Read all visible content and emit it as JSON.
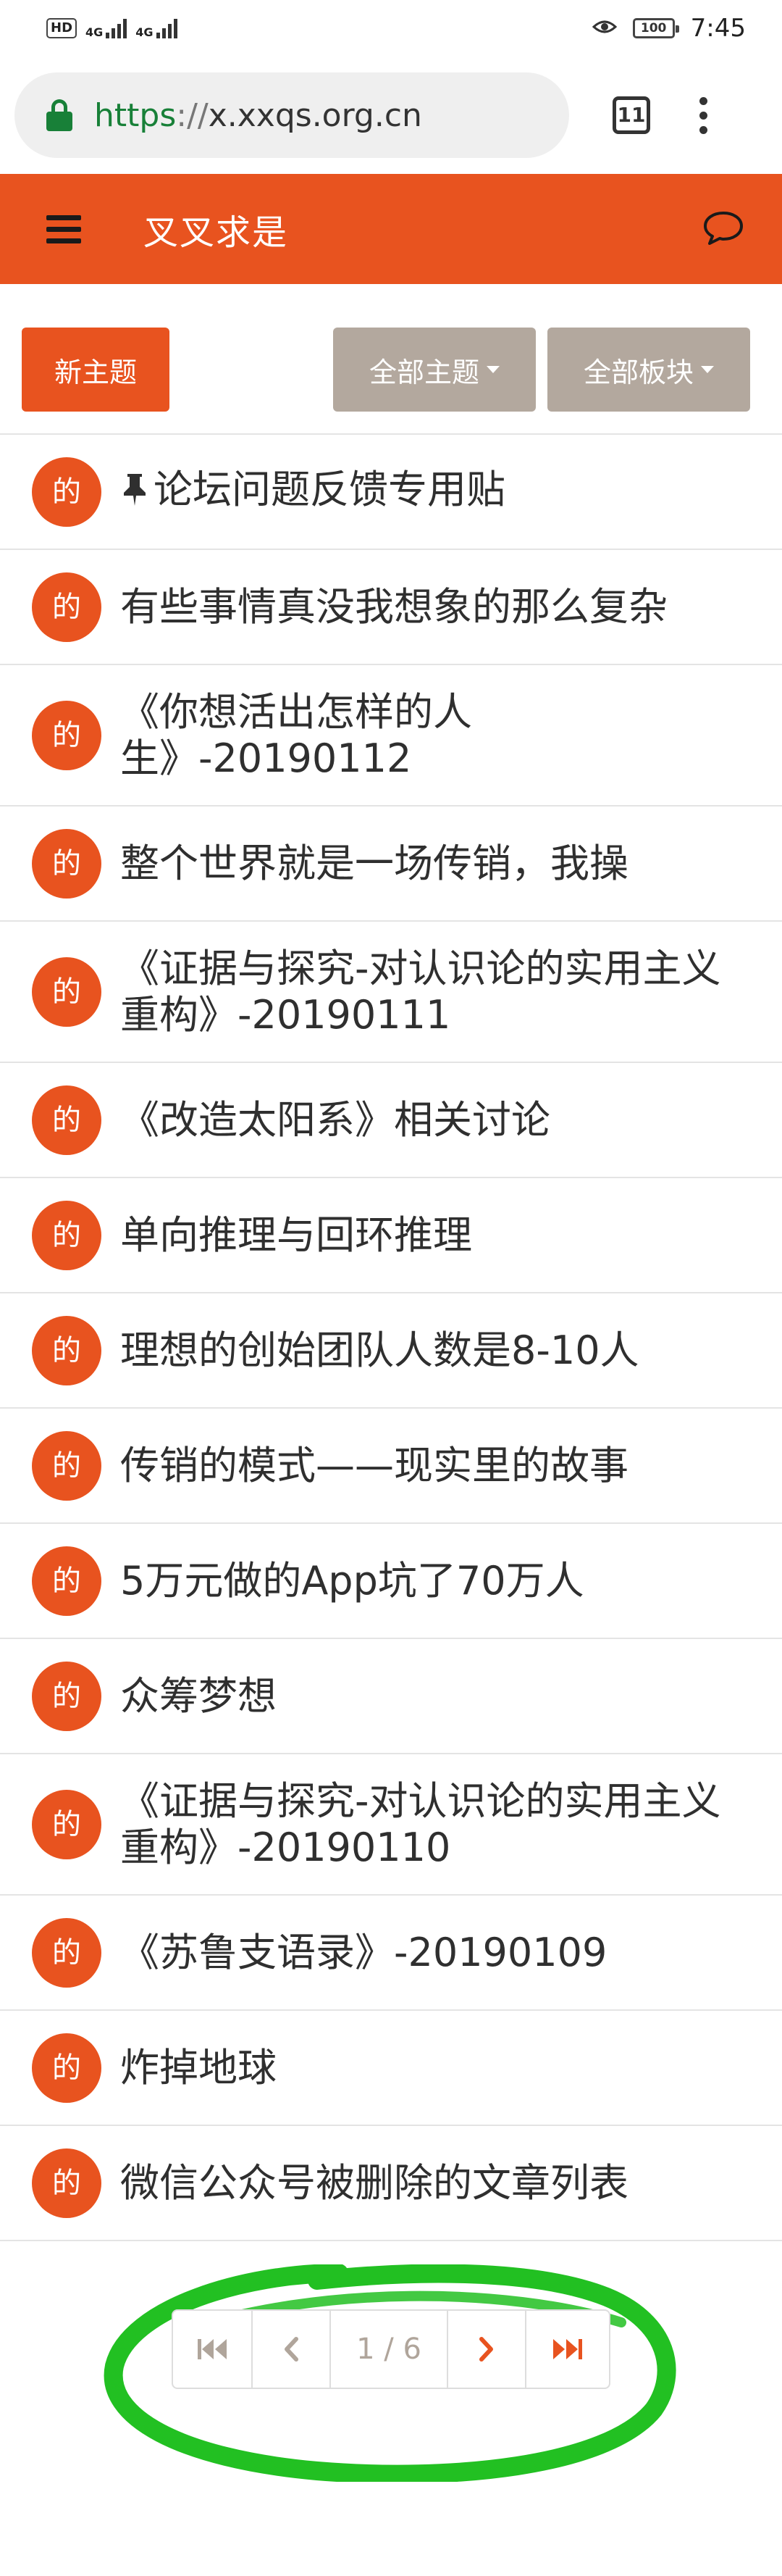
{
  "status_bar": {
    "hd": "HD",
    "net1": "4G",
    "net2": "4G",
    "battery": "100",
    "time": "7:45"
  },
  "browser": {
    "url_scheme": "https",
    "url_sep": "://",
    "url_host": "x.xxqs.org.cn",
    "tab_count": "11"
  },
  "header": {
    "title": "叉叉求是"
  },
  "actions": {
    "new_topic": "新主题",
    "all_topics": "全部主题",
    "all_boards": "全部板块"
  },
  "topics": [
    {
      "avatar": "的",
      "title": "论坛问题反馈专用贴",
      "pinned": true
    },
    {
      "avatar": "的",
      "title": "有些事情真没我想象的那么复杂"
    },
    {
      "avatar": "的",
      "title": "《你想活出怎样的人生》-20190112"
    },
    {
      "avatar": "的",
      "title": "整个世界就是一场传销，我操"
    },
    {
      "avatar": "的",
      "title": "《证据与探究-对认识论的实用主义重构》-20190111"
    },
    {
      "avatar": "的",
      "title": "《改造太阳系》相关讨论"
    },
    {
      "avatar": "的",
      "title": "单向推理与回环推理"
    },
    {
      "avatar": "的",
      "title": "理想的创始团队人数是8-10人"
    },
    {
      "avatar": "的",
      "title": "传销的模式——现实里的故事"
    },
    {
      "avatar": "的",
      "title": "5万元做的App坑了70万人"
    },
    {
      "avatar": "的",
      "title": "众筹梦想"
    },
    {
      "avatar": "的",
      "title": "《证据与探究-对认识论的实用主义重构》-20190110"
    },
    {
      "avatar": "的",
      "title": "《苏鲁支语录》-20190109"
    },
    {
      "avatar": "的",
      "title": "炸掉地球"
    },
    {
      "avatar": "的",
      "title": "微信公众号被删除的文章列表"
    }
  ],
  "pagination": {
    "current": "1 / 6"
  },
  "colors": {
    "brand": "#e8531f",
    "secondary_button": "#b3a89e",
    "annotation": "#22c022"
  }
}
